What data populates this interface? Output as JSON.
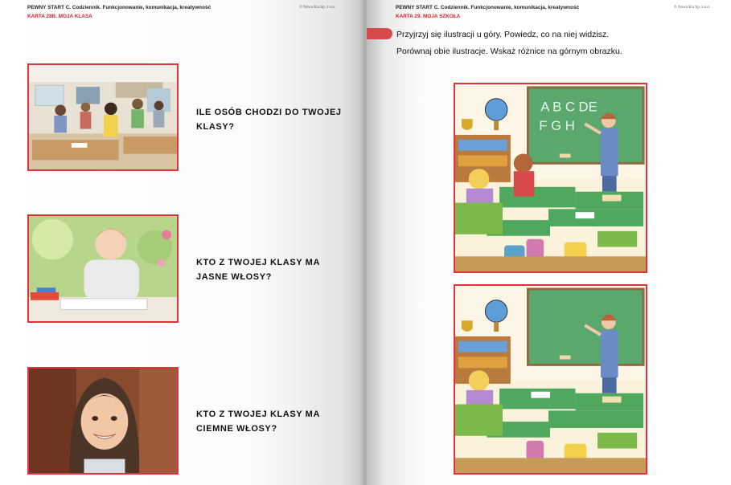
{
  "left_page": {
    "header": "PEWNY START C. Codziennik. Funkcjonowanie, komunikacja, kreatywność",
    "publisher": "© Nowa Era Sp. z o.o.",
    "card_title": "KARTA 28B. MOJA KLASA",
    "questions": [
      {
        "line1": "ILE OSÓB CHODZI DO TWOJEJ",
        "line2": "KLASY?"
      },
      {
        "line1": "KTO Z TWOJEJ KLASY MA",
        "line2": "JASNE WŁOSY?"
      },
      {
        "line1": "KTO Z TWOJEJ KLASY MA",
        "line2": "CIEMNE WŁOSY?"
      }
    ]
  },
  "right_page": {
    "header": "PEWNY START C. Codziennik. Funkcjonowanie, komunikacja, kreatywność",
    "publisher": "© Nowa Era Sp. z o.o.",
    "card_title": "KARTA 29. MOJA SZKOŁA",
    "instruction_1": "Przyjrzyj się ilustracji u góry. Powiedz, co na niej widzisz.",
    "instruction_2": "Porównaj obie ilustracje. Wskaż różnice na górnym obrazku.",
    "board_text_line1": "A B C DE",
    "board_text_line2": "F G H"
  },
  "colors": {
    "accent": "#e0333a",
    "board": "#5aa86e",
    "wall": "#fbf2dc"
  },
  "icons": [
    "classroom-photo",
    "boy-reading-photo",
    "smiling-girl-photo",
    "classroom-illustration"
  ]
}
